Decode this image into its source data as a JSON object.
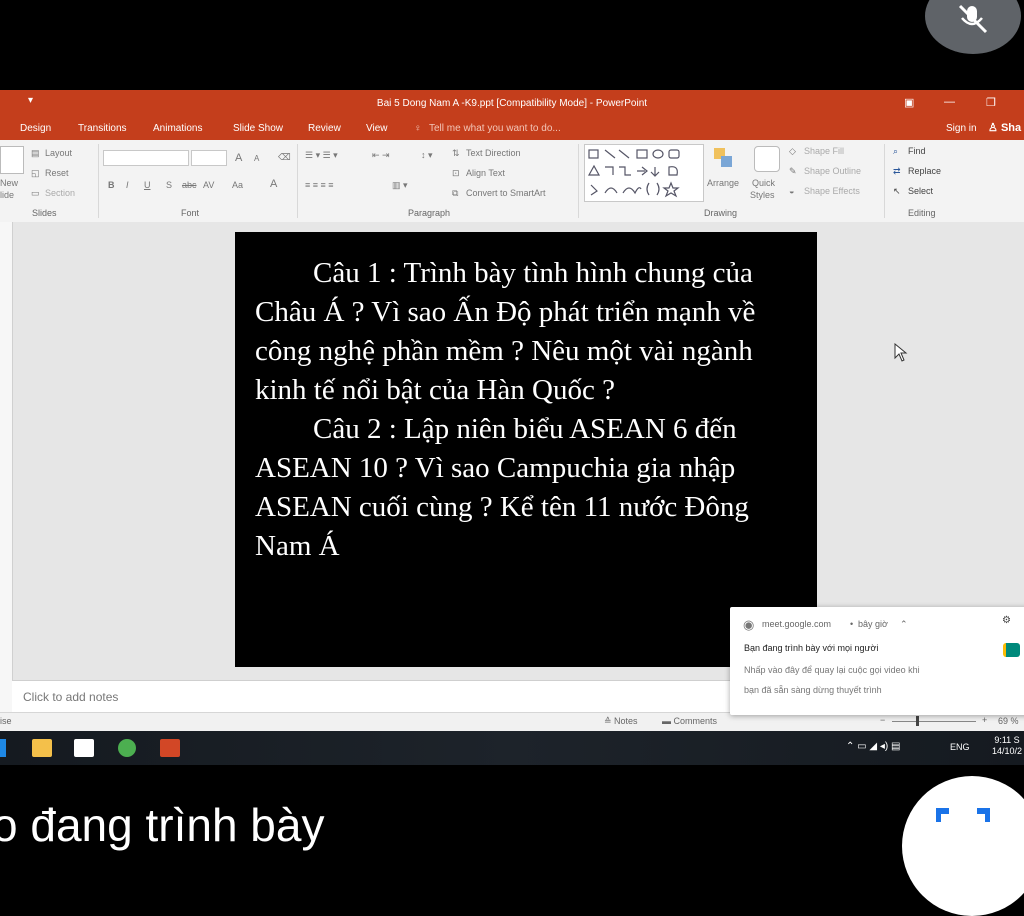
{
  "meet": {
    "presenting_banner": "o đang trình bày"
  },
  "window": {
    "title": "Bai 5 Dong Nam A -K9.ppt [Compatibility Mode] - PowerPoint",
    "minimize_glyph": "—",
    "close_glyph": "✕"
  },
  "ribbon_tabs": {
    "design": "Design",
    "transitions": "Transitions",
    "animations": "Animations",
    "slideshow": "Slide Show",
    "review": "Review",
    "view": "View",
    "tell_me": "Tell me what you want to do...",
    "sign_in": "Sign in",
    "share": "Sha"
  },
  "ribbon": {
    "slides": {
      "new_slide_1": "New",
      "new_slide_2": "lide",
      "layout": "Layout",
      "reset": "Reset",
      "section": "Section",
      "group": "Slides"
    },
    "font": {
      "bold": "B",
      "italic": "I",
      "underline": "U",
      "strike": "S",
      "abc": "abc",
      "spacing": "AV",
      "case": "Aa",
      "color": "A",
      "grow": "A",
      "shrink": "A",
      "group": "Font"
    },
    "paragraph": {
      "text_direction": "Text Direction",
      "align_text": "Align Text",
      "convert_smartart": "Convert to SmartArt",
      "group": "Paragraph"
    },
    "drawing": {
      "arrange": "Arrange",
      "quick_styles_1": "Quick",
      "quick_styles_2": "Styles",
      "shape_fill": "Shape Fill",
      "shape_outline": "Shape Outline",
      "shape_effects": "Shape Effects",
      "group": "Drawing"
    },
    "editing": {
      "find": "Find",
      "replace": "Replace",
      "select": "Select",
      "group": "Editing"
    }
  },
  "slide": {
    "q1": "Câu 1 : Trình bày tình hình chung của Châu Á ? Vì sao Ấn Độ phát triển mạnh về công nghệ phần mềm ? Nêu một vài ngành kinh tế nổi bật của Hàn Quốc ?",
    "q2": "Câu 2 : Lập niên biểu ASEAN 6 đến ASEAN 10 ? Vì sao Campuchia gia nhập ASEAN cuối cùng ? Kể tên 11 nước Đông Nam Á"
  },
  "notes": {
    "placeholder": "Click to add notes"
  },
  "statusbar": {
    "left": "ise",
    "notes": "Notes",
    "comments": "Comments",
    "zoom": "69 %"
  },
  "taskbar": {
    "language": "ENG",
    "time": "9:11 S",
    "date": "14/10/2"
  },
  "notification": {
    "source": "meet.google.com",
    "dot": "•",
    "when": "bây giờ",
    "title": "Bạn đang trình bày với mọi người",
    "body_line1": "Nhấp vào đây để quay lại cuộc gọi video khi",
    "body_line2": "bạn đã sẵn sàng dừng thuyết trình"
  },
  "colors": {
    "ppt_accent": "#c43e1c",
    "slide_bg": "#000000",
    "slide_text": "#ffffff"
  }
}
